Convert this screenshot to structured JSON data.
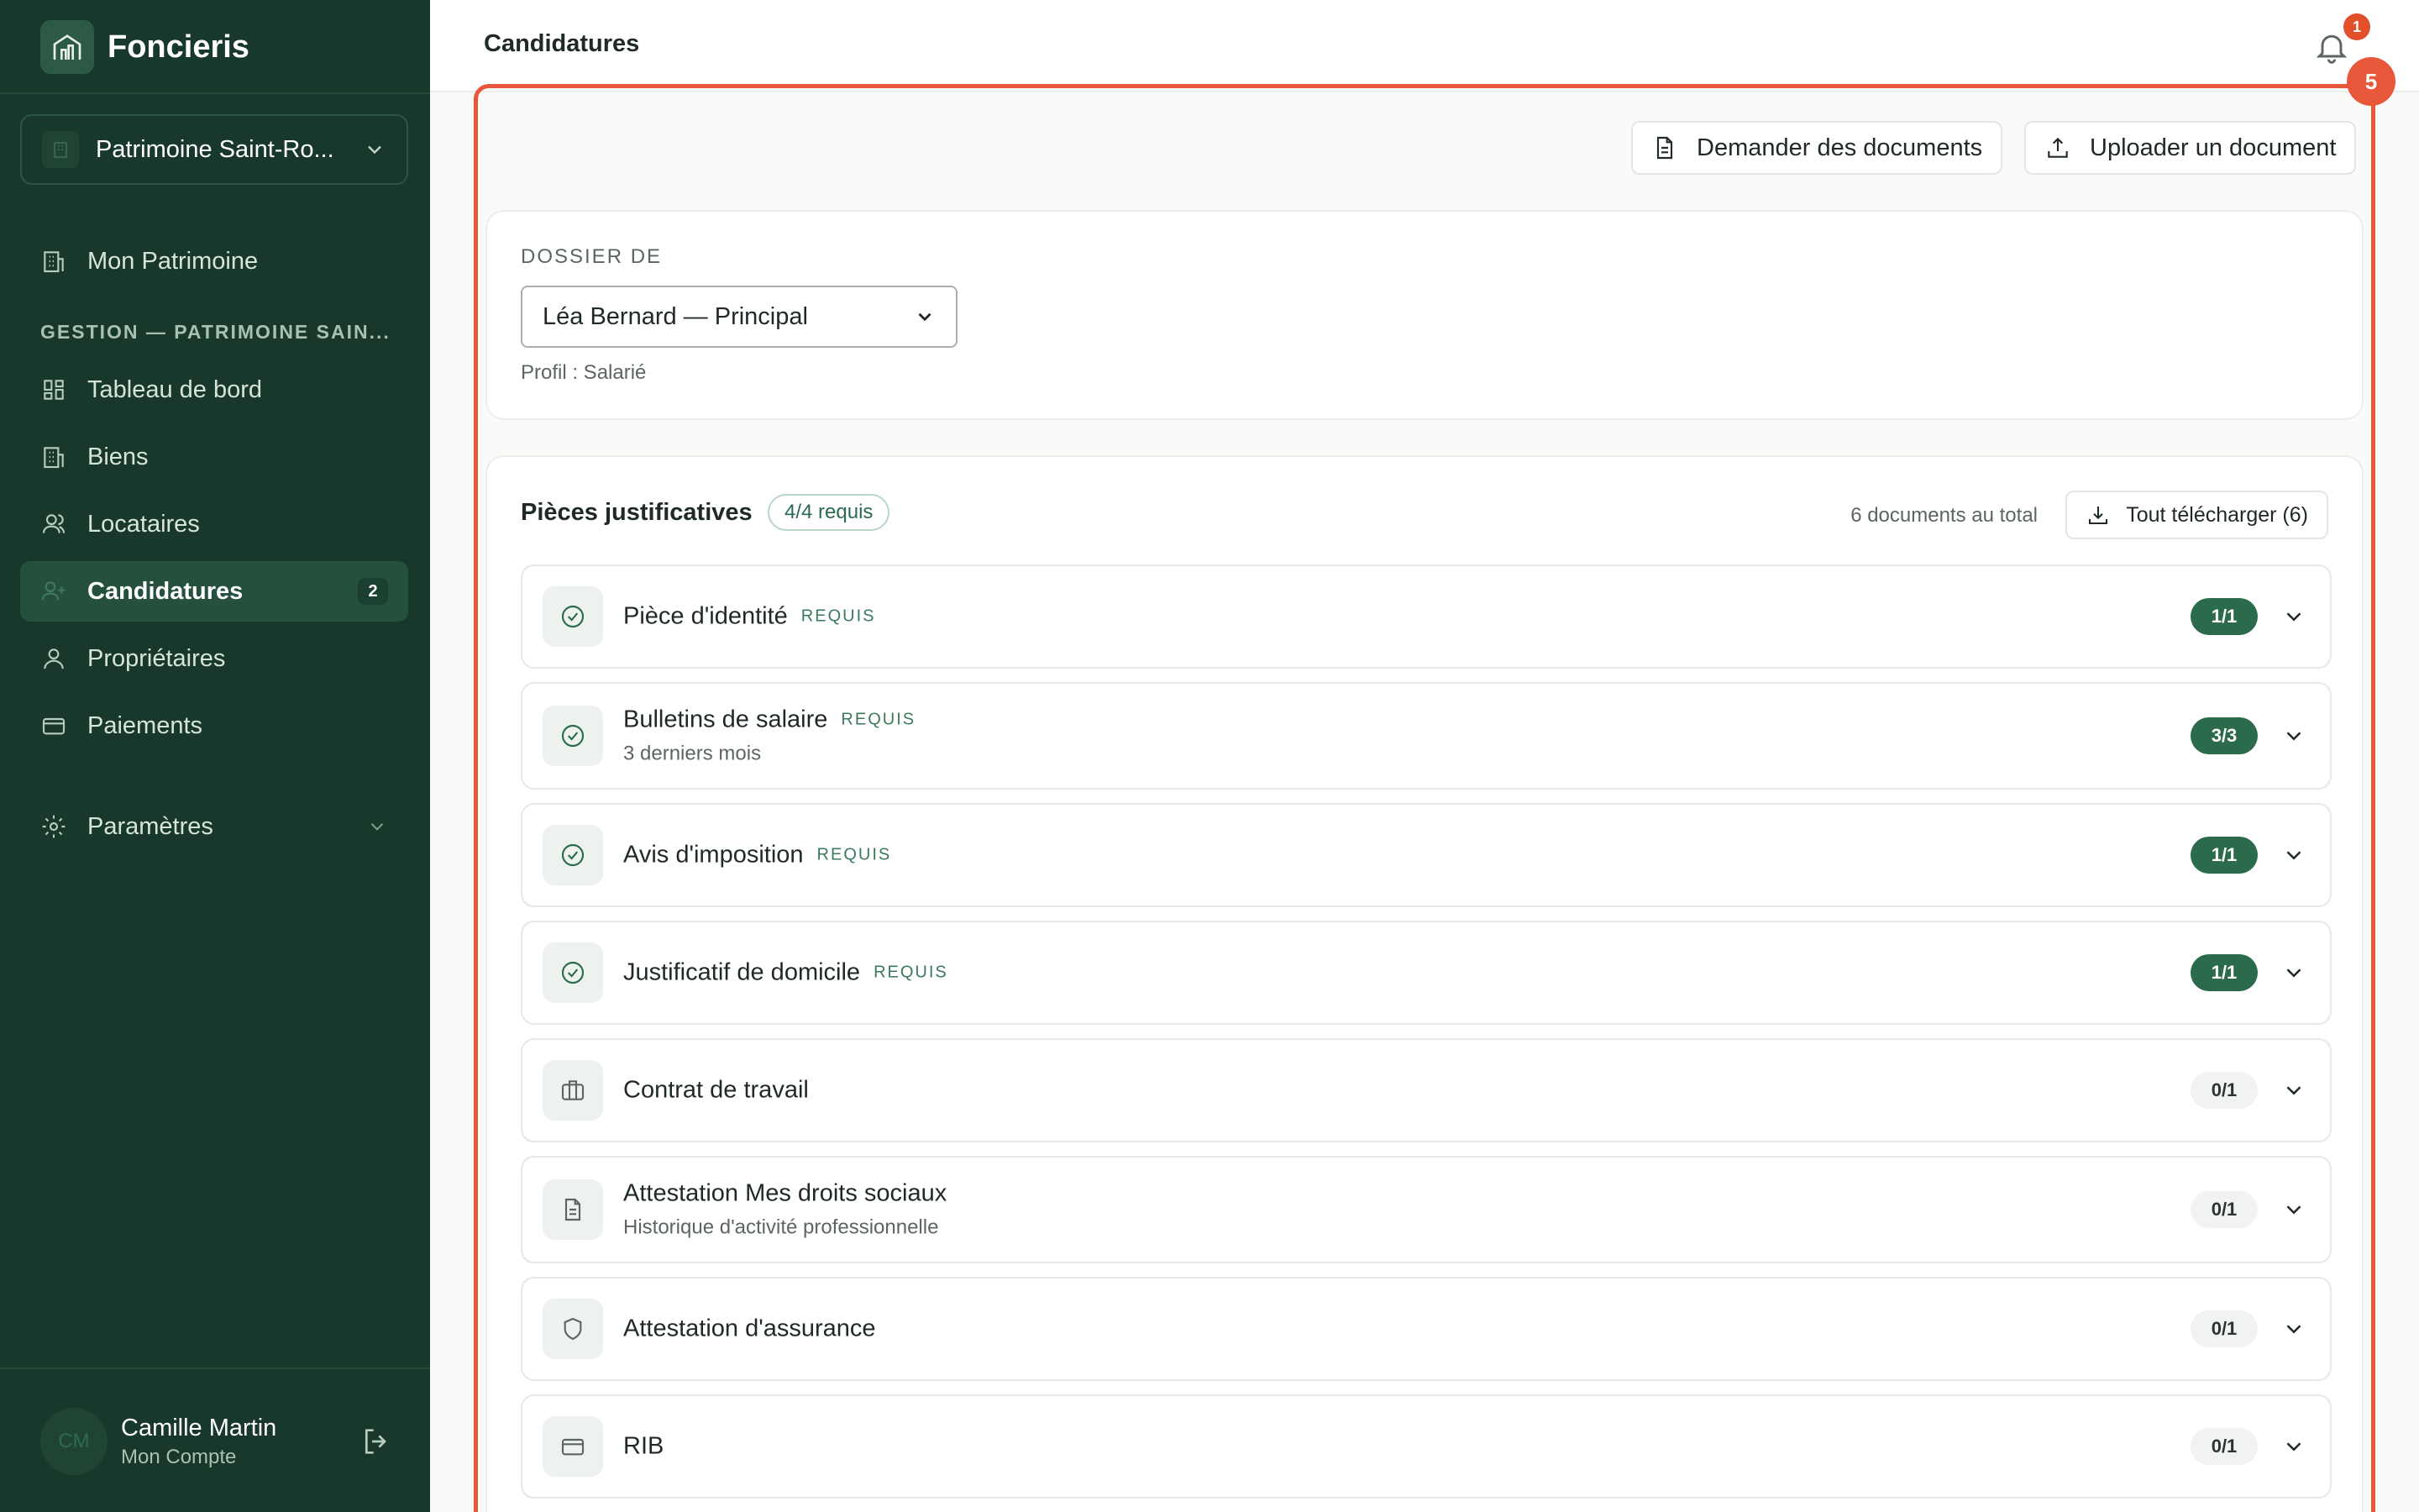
{
  "brand": {
    "name": "Foncieris"
  },
  "org": {
    "name": "Patrimoine Saint-Ro..."
  },
  "nav": {
    "top_item": "Mon Patrimoine",
    "section_label": "GESTION — PATRIMOINE SAIN...",
    "items": [
      {
        "label": "Tableau de bord"
      },
      {
        "label": "Biens"
      },
      {
        "label": "Locataires"
      },
      {
        "label": "Candidatures",
        "badge": "2"
      },
      {
        "label": "Propriétaires"
      },
      {
        "label": "Paiements"
      }
    ],
    "settings": "Paramètres"
  },
  "user": {
    "initials": "CM",
    "name": "Camille Martin",
    "subtitle": "Mon Compte"
  },
  "header": {
    "title": "Candidatures",
    "notifications": "1"
  },
  "highlight_badge": "5",
  "actions": {
    "request_docs": "Demander des documents",
    "upload_doc": "Uploader un document"
  },
  "dossier": {
    "label": "DOSSIER DE",
    "selected": "Léa Bernard — Principal",
    "profile": "Profil : Salarié"
  },
  "docs": {
    "title": "Pièces justificatives",
    "required_pill": "4/4 requis",
    "total": "6 documents au total",
    "download_all": "Tout télécharger (6)",
    "required_tag": "REQUIS",
    "items": [
      {
        "name": "Pièce d'identité",
        "required": true,
        "sub": "",
        "count": "1/1",
        "icon": "check-circle-icon"
      },
      {
        "name": "Bulletins de salaire",
        "required": true,
        "sub": "3 derniers mois",
        "count": "3/3",
        "icon": "check-circle-icon"
      },
      {
        "name": "Avis d'imposition",
        "required": true,
        "sub": "",
        "count": "1/1",
        "icon": "check-circle-icon"
      },
      {
        "name": "Justificatif de domicile",
        "required": true,
        "sub": "",
        "count": "1/1",
        "icon": "check-circle-icon"
      },
      {
        "name": "Contrat de travail",
        "required": false,
        "sub": "",
        "count": "0/1",
        "icon": "briefcase-icon"
      },
      {
        "name": "Attestation Mes droits sociaux",
        "required": false,
        "sub": "Historique d'activité professionnelle",
        "count": "0/1",
        "icon": "document-icon"
      },
      {
        "name": "Attestation d'assurance",
        "required": false,
        "sub": "",
        "count": "0/1",
        "icon": "shield-icon"
      },
      {
        "name": "RIB",
        "required": false,
        "sub": "",
        "count": "0/1",
        "icon": "card-icon"
      }
    ]
  },
  "colors": {
    "sidebar": "#17382b",
    "accent": "#2b6b4c",
    "highlight": "#e8573a"
  }
}
